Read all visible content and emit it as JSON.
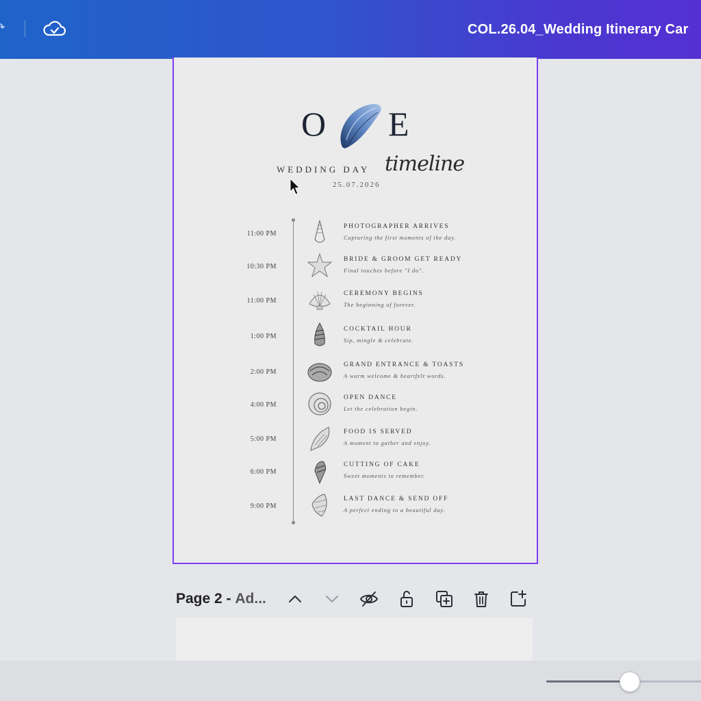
{
  "topbar": {
    "doc_title": "COL.26.04_Wedding Itinerary Car",
    "save_status_icon": "cloud-check-icon"
  },
  "design": {
    "monogram_left": "O",
    "monogram_right": "E",
    "heading": "WEDDING DAY",
    "heading_script": "timeline",
    "date": "25.07.2026",
    "events": [
      {
        "time": "11:00 PM",
        "title": "PHOTOGRAPHER ARRIVES",
        "desc": "Capturing the first moments of the day.",
        "icon": "conch-shell-icon"
      },
      {
        "time": "10:30 PM",
        "title": "BRIDE & GROOM GET READY",
        "desc": "Final touches before \"I do\".",
        "icon": "starfish-icon"
      },
      {
        "time": "11:00 PM",
        "title": "CEREMONY BEGINS",
        "desc": "The beginning of forever.",
        "icon": "scallop-shell-icon"
      },
      {
        "time": "1:00 PM",
        "title": "COCKTAIL HOUR",
        "desc": "Sip, mingle & celebrate.",
        "icon": "spiral-shell-icon"
      },
      {
        "time": "2:00 PM",
        "title": "GRAND ENTRANCE & TOASTS",
        "desc": "A warm welcome & heartfelt words.",
        "icon": "snail-shell-icon"
      },
      {
        "time": "4:00 PM",
        "title": "OPEN DANCE",
        "desc": "Let the celebration begin.",
        "icon": "nautilus-shell-icon"
      },
      {
        "time": "5:00 PM",
        "title": "FOOD IS SERVED",
        "desc": "A moment to gather and enjoy.",
        "icon": "whelk-shell-icon"
      },
      {
        "time": "6:00 PM",
        "title": "CUTTING OF CAKE",
        "desc": "Sweet moments to remember.",
        "icon": "murex-shell-icon"
      },
      {
        "time": "9:00 PM",
        "title": "LAST DANCE & SEND OFF",
        "desc": "A perfect ending to a beautiful day.",
        "icon": "cone-shell-icon"
      }
    ]
  },
  "page_controls": {
    "page_label": "Page 2 -",
    "add_title": "Ad..."
  },
  "zoom": {
    "level_fraction": 0.5
  }
}
